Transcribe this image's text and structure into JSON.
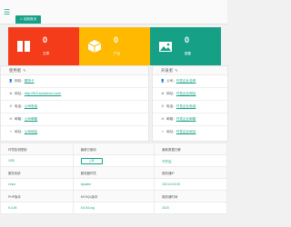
{
  "topbar": {
    "menu_icon": "menu-icon",
    "tab_label": "控制首页",
    "tab_icon": "home-icon"
  },
  "colors": {
    "accent": "#16a085",
    "red": "#f43c1b",
    "yellow": "#ffb900"
  },
  "stats": [
    {
      "icon": "book-icon",
      "value": "0",
      "label": "文章"
    },
    {
      "icon": "box-icon",
      "value": "0",
      "label": "产品"
    },
    {
      "icon": "image-icon",
      "value": "0",
      "label": "图集"
    }
  ],
  "usage": {
    "title": "使用者",
    "rows": [
      {
        "icon": "user-icon",
        "key": "网站：",
        "value": "赛特卡"
      },
      {
        "icon": "globe-icon",
        "key": "网址：",
        "value": "http://515.suosehoo.com/"
      },
      {
        "icon": "phone-icon",
        "key": "电话：",
        "value": "公司电话"
      },
      {
        "icon": "envelope-icon",
        "key": "邮箱：",
        "value": "公司邮箱"
      },
      {
        "icon": "location-icon",
        "key": "地址：",
        "value": "公司地址"
      }
    ]
  },
  "developer": {
    "title": "开发者",
    "rows": [
      {
        "icon": "user-icon",
        "key": "公司：",
        "value": "开发企业名称"
      },
      {
        "icon": "globe-icon",
        "key": "网址：",
        "value": "开发企业网址"
      },
      {
        "icon": "phone-icon",
        "key": "电话：",
        "value": "开发企业电话"
      },
      {
        "icon": "envelope-icon",
        "key": "邮箱：",
        "value": "开发企业邮箱"
      },
      {
        "icon": "location-icon",
        "key": "地址：",
        "value": "开发企业地址"
      }
    ]
  },
  "system": {
    "rows": [
      [
        "环境检测限制",
        "最新已使用",
        "最新数据已解"
      ],
      [
        "1GB",
        "上传",
        "不开启"
      ],
      [
        "服务系统",
        "服务器环境",
        "服务器IP"
      ],
      [
        "Linux",
        "Apache",
        "103.10.02.00"
      ],
      [
        "PHP版本",
        "MYSQL版本",
        "服务器时间"
      ],
      [
        "5.4.45",
        "5.5.54-log",
        "2020"
      ]
    ]
  }
}
